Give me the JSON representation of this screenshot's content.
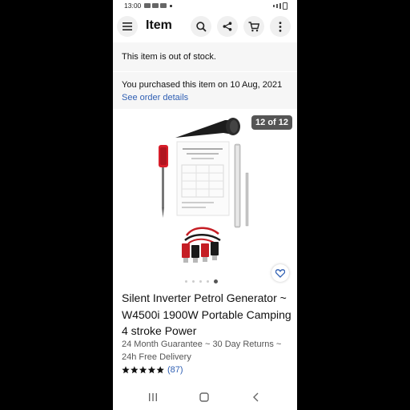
{
  "status_bar": {
    "time": "13:00"
  },
  "header": {
    "title": "Item",
    "menu_icon": "hamburger-icon",
    "search_icon": "search-icon",
    "share_icon": "share-icon",
    "cart_icon": "cart-icon",
    "more_icon": "more-vertical-icon"
  },
  "stock_notice": {
    "text": "This item is out of stock."
  },
  "purchase_notice": {
    "text": "You purchased this item on 10 Aug, 2021",
    "link_text": "See order details"
  },
  "gallery": {
    "counter": "12 of 12",
    "current_index": 12,
    "total": 12,
    "favourite_icon": "heart-icon"
  },
  "product": {
    "title": "Silent Inverter Petrol Generator ~ W4500i 1900W Portable Camping 4 stroke Power",
    "shipping": "24 Month Guarantee ~ 30 Day Returns ~ 24h Free Delivery",
    "rating": {
      "stars": 5,
      "count_text": "(87)"
    }
  },
  "nav_bar": {
    "recent_icon": "recent-apps-icon",
    "home_icon": "home-icon",
    "back_icon": "back-icon"
  },
  "colors": {
    "link": "#2f5fb3",
    "banner_bg": "#f6f6f6",
    "counter_bg": "#555555"
  }
}
